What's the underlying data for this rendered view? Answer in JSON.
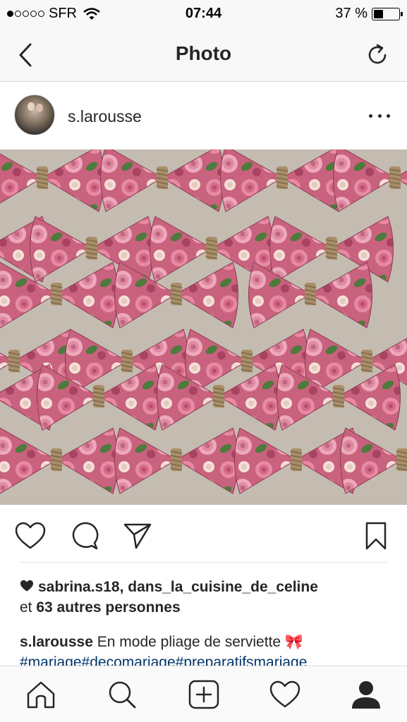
{
  "status_bar": {
    "carrier": "SFR",
    "time": "07:44",
    "battery_percent": "37 %",
    "battery_level": 0.37,
    "signal_bars_filled": 1,
    "signal_bars_total": 5
  },
  "nav": {
    "title": "Photo",
    "back_icon": "chevron-left-icon",
    "refresh_icon": "refresh-icon"
  },
  "post": {
    "username": "s.larousse",
    "more_icon": "more-horizontal-icon",
    "photo_alt": "floral napkins folded into bows"
  },
  "actions": {
    "like_icon": "heart-icon",
    "comment_icon": "comment-icon",
    "share_icon": "send-icon",
    "save_icon": "bookmark-icon"
  },
  "likes": {
    "icon": "heart-filled-icon",
    "users": "sabrina.s18, dans_la_cuisine_de_celine",
    "conjunction": "et",
    "others": "63 autres personnes"
  },
  "caption": {
    "author": "s.larousse",
    "text": "En mode pliage de serviette 🎀",
    "hashtags": "#mariage#decomariage#preparatifsmariage"
  },
  "tab_bar": {
    "items": [
      {
        "name": "home",
        "icon": "home-icon"
      },
      {
        "name": "search",
        "icon": "search-icon"
      },
      {
        "name": "add",
        "icon": "add-icon"
      },
      {
        "name": "activity",
        "icon": "heart-icon"
      },
      {
        "name": "profile",
        "icon": "profile-icon"
      }
    ]
  },
  "colors": {
    "text": "#262626",
    "hashtag": "#003569",
    "bar_bg": "#f8f8f8"
  }
}
